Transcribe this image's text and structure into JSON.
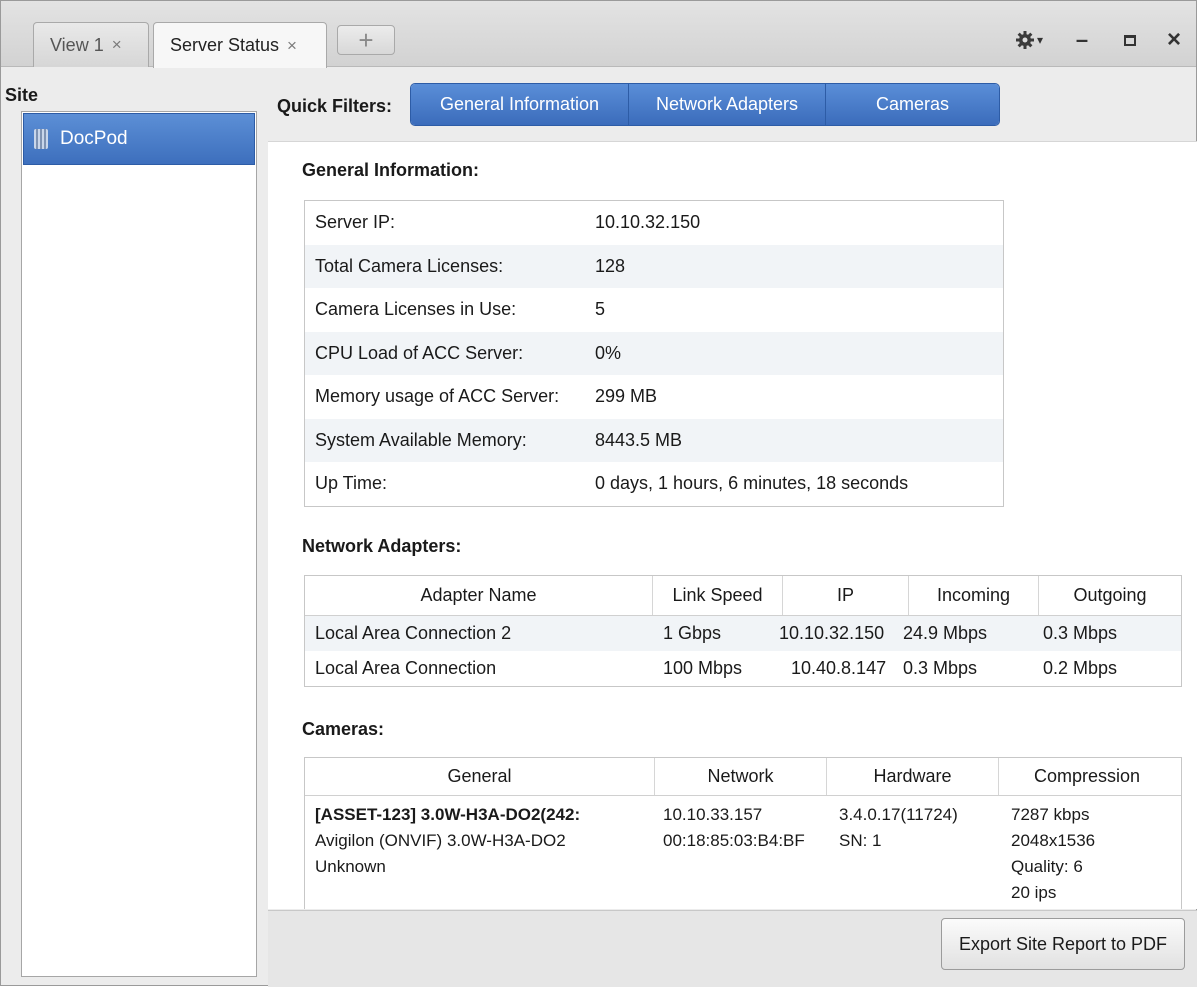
{
  "tabs": [
    {
      "label": "View 1",
      "close": "×"
    },
    {
      "label": "Server Status",
      "close": "×"
    }
  ],
  "add_tab": "+",
  "window_controls": {
    "settings_caret": "▾",
    "minimize": "–",
    "maximize": "□",
    "close": "×"
  },
  "site": {
    "title": "Site",
    "items": [
      {
        "label": "DocPod"
      }
    ]
  },
  "quick_filters": {
    "label": "Quick Filters:",
    "buttons": [
      "General Information",
      "Network Adapters",
      "Cameras"
    ]
  },
  "general": {
    "title": "General Information:",
    "rows": [
      {
        "key": "Server IP:",
        "value": "10.10.32.150"
      },
      {
        "key": "Total Camera Licenses:",
        "value": "128"
      },
      {
        "key": "Camera Licenses in Use:",
        "value": "5"
      },
      {
        "key": "CPU Load of ACC Server:",
        "value": "0%"
      },
      {
        "key": "Memory usage of ACC Server:",
        "value": "299 MB"
      },
      {
        "key": "System Available Memory:",
        "value": "8443.5 MB"
      },
      {
        "key": "Up Time:",
        "value": "0 days, 1 hours, 6 minutes, 18 seconds"
      }
    ]
  },
  "network": {
    "title": "Network Adapters:",
    "columns": [
      "Adapter Name",
      "Link Speed",
      "IP",
      "Incoming",
      "Outgoing"
    ],
    "rows": [
      [
        "Local Area Connection 2",
        "1 Gbps",
        "10.10.32.150",
        "24.9 Mbps",
        "0.3 Mbps"
      ],
      [
        "Local Area Connection",
        "100 Mbps",
        "10.40.8.147",
        "0.3 Mbps",
        "0.2 Mbps"
      ]
    ]
  },
  "cameras": {
    "title": "Cameras:",
    "columns": [
      "General",
      "Network",
      "Hardware",
      "Compression"
    ],
    "rows": [
      {
        "general_name": "[ASSET-123] 3.0W-H3A-DO2(242:",
        "general_model": "Avigilon (ONVIF) 3.0W-H3A-DO2",
        "general_status": "Unknown",
        "network_ip": "10.10.33.157",
        "network_mac": "00:18:85:03:B4:BF",
        "hardware_version": "3.4.0.17(11724)",
        "hardware_sn": "SN: 1",
        "compression_bitrate": "7287 kbps",
        "compression_resolution": "2048x1536",
        "compression_quality": "Quality: 6",
        "compression_fps": "20 ips"
      }
    ]
  },
  "footer": {
    "export_label": "Export Site Report to PDF"
  }
}
